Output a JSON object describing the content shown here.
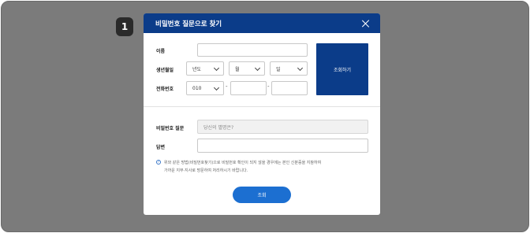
{
  "step": "1",
  "modal": {
    "title": "비밀번호 질문으로 찾기"
  },
  "form": {
    "name_label": "이름",
    "birth_label": "생년월일",
    "birth_year": "년도",
    "birth_month": "월",
    "birth_day": "일",
    "phone_label": "전화번호",
    "phone_prefix": "010",
    "phone_sep": "-",
    "search_button": "조회하기"
  },
  "question": {
    "label": "비밀번호 질문",
    "value": "당신의 별명은?",
    "answer_label": "답변"
  },
  "notice": {
    "line1": "위와 같은 방법(비밀번호찾기)으로 비밀번호 확인이 되지 않을 경우에는 본인 신분증을 지참하여",
    "line2": "가까운 지부·지사로 방문하여 처리하시기 바랍니다."
  },
  "submit_button": "조회",
  "colors": {
    "header": "#0b3c89",
    "primary_button": "#1c6fd1",
    "backdrop": "#7b7b7b"
  }
}
